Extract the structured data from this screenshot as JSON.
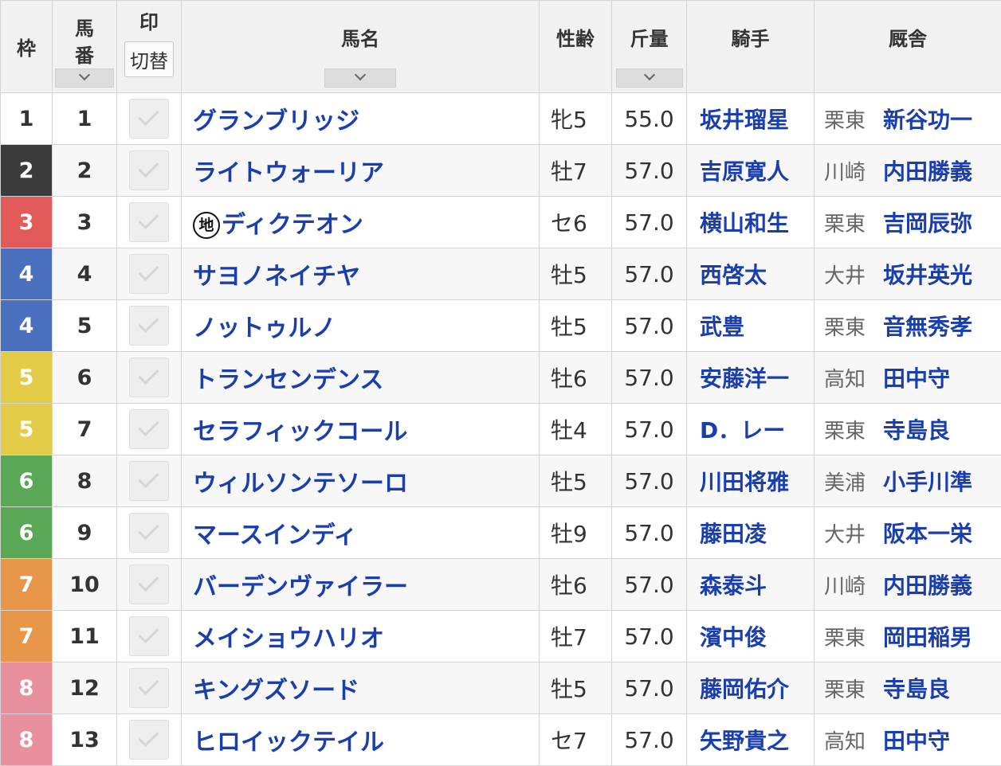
{
  "header": {
    "waku": "枠",
    "umaban_1": "馬",
    "umaban_2": "番",
    "mark": "印",
    "mark_toggle": "切替",
    "name": "馬名",
    "sexage": "性齢",
    "weight": "斤量",
    "jockey": "騎手",
    "stable": "厩舎"
  },
  "waku_colors": {
    "1": {
      "bg": "#ffffff",
      "fg": "#333333"
    },
    "2": {
      "bg": "#3b3b3b",
      "fg": "#ffffff"
    },
    "3": {
      "bg": "#e05a5a",
      "fg": "#ffffff"
    },
    "4": {
      "bg": "#4a6fbf",
      "fg": "#ffffff"
    },
    "5": {
      "bg": "#e3cc47",
      "fg": "#ffffff"
    },
    "6": {
      "bg": "#5aa855",
      "fg": "#ffffff"
    },
    "7": {
      "bg": "#e8964a",
      "fg": "#ffffff"
    },
    "8": {
      "bg": "#e8909e",
      "fg": "#ffffff"
    }
  },
  "horses": [
    {
      "waku": "1",
      "umaban": "1",
      "chi": "",
      "name": "グランブリッジ",
      "sexage": "牝5",
      "weight": "55.0",
      "jockey": "坂井瑠星",
      "region": "栗東",
      "trainer": "新谷功一"
    },
    {
      "waku": "2",
      "umaban": "2",
      "chi": "",
      "name": "ライトウォーリア",
      "sexage": "牡7",
      "weight": "57.0",
      "jockey": "吉原寛人",
      "region": "川崎",
      "trainer": "内田勝義"
    },
    {
      "waku": "3",
      "umaban": "3",
      "chi": "地",
      "name": "ディクテオン",
      "sexage": "セ6",
      "weight": "57.0",
      "jockey": "横山和生",
      "region": "栗東",
      "trainer": "吉岡辰弥"
    },
    {
      "waku": "4",
      "umaban": "4",
      "chi": "",
      "name": "サヨノネイチヤ",
      "sexage": "牡5",
      "weight": "57.0",
      "jockey": "西啓太",
      "region": "大井",
      "trainer": "坂井英光"
    },
    {
      "waku": "4",
      "umaban": "5",
      "chi": "",
      "name": "ノットゥルノ",
      "sexage": "牡5",
      "weight": "57.0",
      "jockey": "武豊",
      "region": "栗東",
      "trainer": "音無秀孝"
    },
    {
      "waku": "5",
      "umaban": "6",
      "chi": "",
      "name": "トランセンデンス",
      "sexage": "牡6",
      "weight": "57.0",
      "jockey": "安藤洋一",
      "region": "高知",
      "trainer": "田中守"
    },
    {
      "waku": "5",
      "umaban": "7",
      "chi": "",
      "name": "セラフィックコール",
      "sexage": "牡4",
      "weight": "57.0",
      "jockey": "D．レー",
      "region": "栗東",
      "trainer": "寺島良"
    },
    {
      "waku": "6",
      "umaban": "8",
      "chi": "",
      "name": "ウィルソンテソーロ",
      "sexage": "牡5",
      "weight": "57.0",
      "jockey": "川田将雅",
      "region": "美浦",
      "trainer": "小手川準"
    },
    {
      "waku": "6",
      "umaban": "9",
      "chi": "",
      "name": "マースインディ",
      "sexage": "牡9",
      "weight": "57.0",
      "jockey": "藤田凌",
      "region": "大井",
      "trainer": "阪本一栄"
    },
    {
      "waku": "7",
      "umaban": "10",
      "chi": "",
      "name": "バーデンヴァイラー",
      "sexage": "牡6",
      "weight": "57.0",
      "jockey": "森泰斗",
      "region": "川崎",
      "trainer": "内田勝義"
    },
    {
      "waku": "7",
      "umaban": "11",
      "chi": "",
      "name": "メイショウハリオ",
      "sexage": "牡7",
      "weight": "57.0",
      "jockey": "濱中俊",
      "region": "栗東",
      "trainer": "岡田稲男"
    },
    {
      "waku": "8",
      "umaban": "12",
      "chi": "",
      "name": "キングズソード",
      "sexage": "牡5",
      "weight": "57.0",
      "jockey": "藤岡佑介",
      "region": "栗東",
      "trainer": "寺島良"
    },
    {
      "waku": "8",
      "umaban": "13",
      "chi": "",
      "name": "ヒロイックテイル",
      "sexage": "セ7",
      "weight": "57.0",
      "jockey": "矢野貴之",
      "region": "高知",
      "trainer": "田中守"
    }
  ]
}
